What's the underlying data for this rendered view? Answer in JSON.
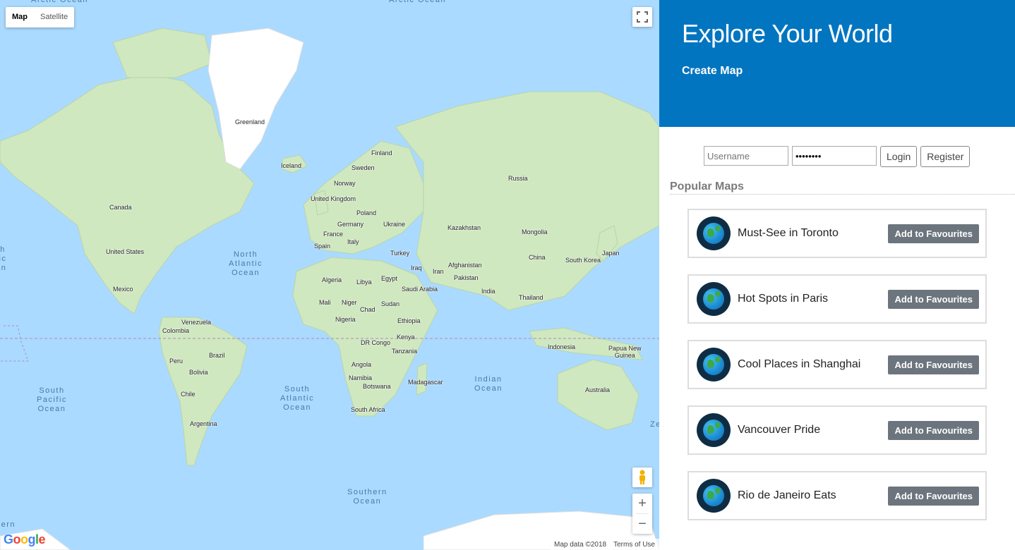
{
  "map": {
    "type_buttons": [
      "Map",
      "Satellite"
    ],
    "active_type": "Map",
    "countries": [
      "Greenland",
      "Iceland",
      "Finland",
      "Sweden",
      "Norway",
      "United Kingdom",
      "Poland",
      "Germany",
      "Ukraine",
      "France",
      "Spain",
      "Italy",
      "Turkey",
      "Kazakhstan",
      "Mongolia",
      "Russia",
      "Canada",
      "United States",
      "Mexico",
      "Venezuela",
      "Colombia",
      "Brazil",
      "Peru",
      "Bolivia",
      "Chile",
      "Argentina",
      "Algeria",
      "Libya",
      "Egypt",
      "Mali",
      "Niger",
      "Chad",
      "Sudan",
      "Nigeria",
      "Ethiopia",
      "Kenya",
      "DR Congo",
      "Tanzania",
      "Angola",
      "Namibia",
      "Botswana",
      "South Africa",
      "Madagascar",
      "Iraq",
      "Iran",
      "Saudi Arabia",
      "Afghanistan",
      "Pakistan",
      "India",
      "China",
      "South Korea",
      "Japan",
      "Thailand",
      "Indonesia",
      "Papua New\nGuinea",
      "Australia"
    ],
    "oceans": [
      "Arctic Ocean",
      "Arctic Ocean",
      "North\nAtlantic\nOcean",
      "South\nAtlantic\nOcean",
      "South\nPacific\nOcean",
      "Indian\nOcean",
      "Southern\nOcean",
      "th\nfic\nan",
      "hern",
      "Ze"
    ],
    "attribution": [
      "Map data ©2018",
      "Terms of Use"
    ],
    "logo": "Google",
    "zoom_in": "+",
    "zoom_out": "−"
  },
  "header": {
    "title": "Explore Your World",
    "create_link": "Create Map"
  },
  "login": {
    "username_placeholder": "Username",
    "password_value": "********",
    "login_label": "Login",
    "register_label": "Register"
  },
  "popular": {
    "title": "Popular Maps",
    "maps": [
      {
        "name": "Must-See in Toronto",
        "button": "Add to Favourites"
      },
      {
        "name": "Hot Spots in Paris",
        "button": "Add to Favourites"
      },
      {
        "name": "Cool Places in Shanghai",
        "button": "Add to Favourites"
      },
      {
        "name": "Vancouver Pride",
        "button": "Add to Favourites"
      },
      {
        "name": "Rio de Janeiro Eats",
        "button": "Add to Favourites"
      }
    ]
  }
}
